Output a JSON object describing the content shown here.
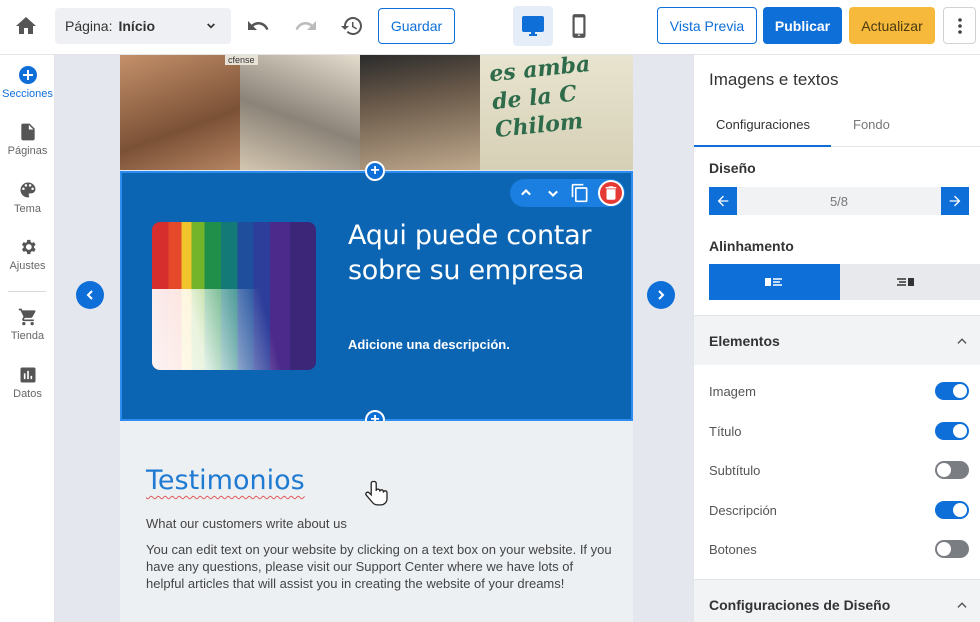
{
  "topbar": {
    "page_label": "Página:",
    "page_value": "Início",
    "save": "Guardar",
    "preview": "Vista Previa",
    "publish": "Publicar",
    "update": "Actualizar"
  },
  "sidebar": {
    "items": [
      {
        "label": "Secciones",
        "icon": "plus-circle-icon"
      },
      {
        "label": "Páginas",
        "icon": "page-icon"
      },
      {
        "label": "Tema",
        "icon": "palette-icon"
      },
      {
        "label": "Ajustes",
        "icon": "gear-icon"
      },
      {
        "label": "Tienda",
        "icon": "cart-icon"
      },
      {
        "label": "Datos",
        "icon": "chart-icon"
      }
    ]
  },
  "canvas": {
    "hero_wall_text": [
      "es amba",
      "de la C",
      "Chilom"
    ],
    "hero_tag": "cfense",
    "section": {
      "title": "Aqui puede contar sobre su empresa",
      "description": "Adicione una descripción."
    },
    "testimonials": {
      "title": "Testimonios",
      "subtitle": "What our customers write about us",
      "body": "You can edit text on your website by clicking on a text box on your website. If you have any questions, please visit our Support Center where we have lots of helpful articles that will assist you in creating the website of your dreams!"
    }
  },
  "panel": {
    "title": "Imagens e textos",
    "tabs": [
      "Configuraciones",
      "Fondo"
    ],
    "design_label": "Diseño",
    "design_value": "5/8",
    "align_label": "Alinhamento",
    "elements_label": "Elementos",
    "elements": [
      {
        "label": "Imagem",
        "on": true
      },
      {
        "label": "Título",
        "on": true
      },
      {
        "label": "Subtítulo",
        "on": false
      },
      {
        "label": "Descripción",
        "on": true
      },
      {
        "label": "Botones",
        "on": false
      }
    ],
    "design_config_label": "Configuraciones de Diseño"
  },
  "colors": {
    "accent": "#0e6fd8",
    "section_bg": "#0c65b3",
    "update_btn": "#f6b93b",
    "delete": "#e53935"
  }
}
